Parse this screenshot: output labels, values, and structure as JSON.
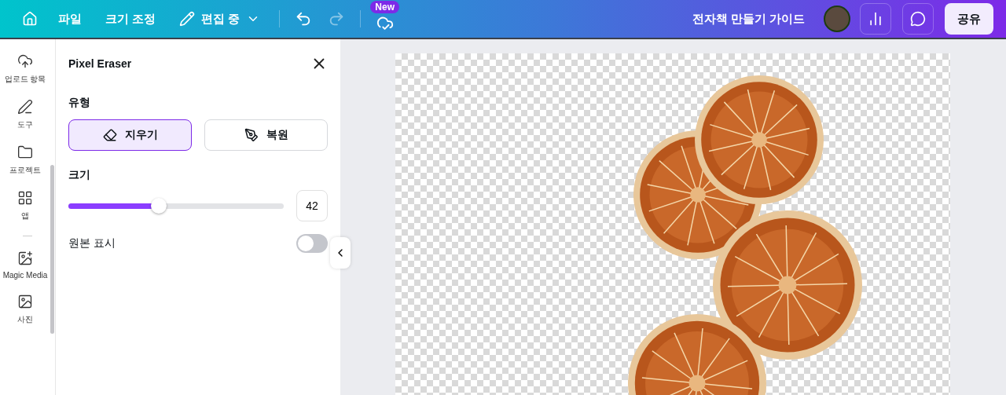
{
  "topbar": {
    "menu": [
      {
        "label": "파일",
        "kind": "text"
      },
      {
        "label": "크기 조정",
        "kind": "text"
      },
      {
        "label": "편집 중",
        "kind": "edit"
      }
    ],
    "history": [
      {
        "kind": "undo",
        "disabled": false
      },
      {
        "kind": "redo",
        "disabled": true
      }
    ],
    "badge": "New",
    "title": "전자책 만들기 가이드",
    "share": "공유"
  },
  "sidebar": {
    "items": [
      {
        "label": "업로드 항목",
        "kind": "upload"
      },
      {
        "label": "도구",
        "kind": "draw"
      },
      {
        "label": "프로젝트",
        "kind": "folder"
      },
      {
        "label": "앱",
        "kind": "apps"
      },
      {
        "label": "Magic Media",
        "kind": "magic"
      },
      {
        "label": "사진",
        "kind": "photo"
      }
    ]
  },
  "panel": {
    "title": "Pixel Eraser",
    "type_label": "유형",
    "modes": [
      {
        "label": "지우기",
        "kind": "erase",
        "selected": true
      },
      {
        "label": "복원",
        "kind": "restore",
        "selected": false
      }
    ],
    "size_label": "크기",
    "size": {
      "level": 0.42,
      "value": "42"
    },
    "show_original": {
      "label": "원본 표시",
      "on": false
    }
  }
}
